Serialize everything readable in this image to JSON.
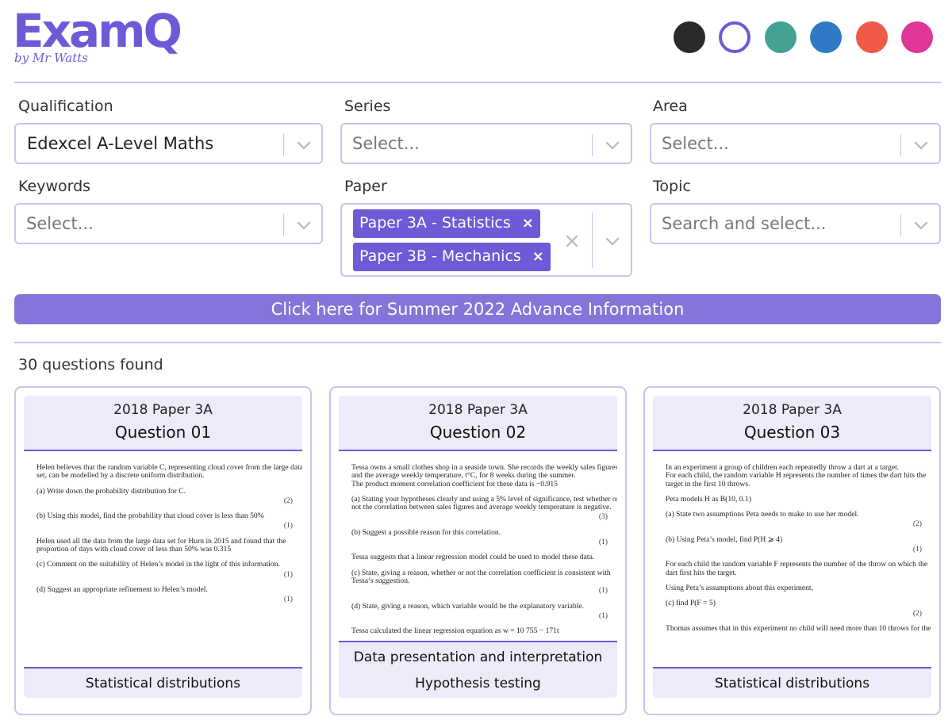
{
  "brand": {
    "name": "ExamQ",
    "tagline": "by Mr Watts",
    "accent": "#6c5ad6"
  },
  "theme_swatches": [
    {
      "name": "dark",
      "color": "#2a2a2a",
      "selected": false
    },
    {
      "name": "purple",
      "color": "#6c5ad6",
      "selected": true
    },
    {
      "name": "teal",
      "color": "#45a191",
      "selected": false
    },
    {
      "name": "blue",
      "color": "#2f79c5",
      "selected": false
    },
    {
      "name": "red",
      "color": "#ef5a48",
      "selected": false
    },
    {
      "name": "pink",
      "color": "#df3795",
      "selected": false
    }
  ],
  "filters": {
    "qualification": {
      "label": "Qualification",
      "value": "Edexcel A-Level Maths"
    },
    "series": {
      "label": "Series",
      "placeholder": "Select..."
    },
    "area": {
      "label": "Area",
      "placeholder": "Select..."
    },
    "keywords": {
      "label": "Keywords",
      "placeholder": "Select..."
    },
    "paper": {
      "label": "Paper",
      "tags": [
        "Paper 3A - Statistics",
        "Paper 3B - Mechanics"
      ],
      "tag_remove": "×"
    },
    "topic": {
      "label": "Topic",
      "placeholder": "Search and select..."
    }
  },
  "banner": {
    "text": "Click here for Summer 2022 Advance Information"
  },
  "results": {
    "count_text": "30 questions found"
  },
  "cards": [
    {
      "year": "2018 Paper 3A",
      "question": "Question 01",
      "topics": [
        "Statistical distributions"
      ],
      "content": [
        {
          "t": "Helen believes that the random variable C, representing cloud cover from the large data"
        },
        {
          "t": "set, can be modelled by a discrete uniform distribution."
        },
        {
          "t": "(a)  Write down the probability distribution for C."
        },
        {
          "m": "(2)"
        },
        {
          "t": "(b)  Using this model, find the probability that cloud cover is less than 50%"
        },
        {
          "m": "(1)"
        },
        {
          "t": "Helen used all the data from the large data set for Hurn in 2015 and found that the"
        },
        {
          "t": "proportion of days with cloud cover of less than 50% was 0.315"
        },
        {
          "t": "(c)  Comment on the suitability of Helen’s model in the light of this information."
        },
        {
          "m": "(1)"
        },
        {
          "t": "(d)  Suggest an appropriate refinement to Helen’s model."
        },
        {
          "m": "(1)"
        }
      ]
    },
    {
      "year": "2018 Paper 3A",
      "question": "Question 02",
      "topics": [
        "Data presentation and interpretation",
        "Hypothesis testing"
      ],
      "content": [
        {
          "t": "Tessa owns a small clothes shop in a seaside town.  She records the weekly sales figures, £w,"
        },
        {
          "t": "and the average weekly temperature, t°C, for 8 weeks during the summer."
        },
        {
          "t": "The product moment correlation coefficient for these data is −0.915"
        },
        {
          "t": "(a)  Stating your hypotheses clearly and using a 5% level of significance, test whether or"
        },
        {
          "t": "       not the correlation between sales figures and average weekly temperature is negative."
        },
        {
          "m": "(3)"
        },
        {
          "t": "(b)  Suggest a possible reason for this correlation."
        },
        {
          "m": "(1)"
        },
        {
          "t": "Tessa suggests that a linear regression model could be used to model these data."
        },
        {
          "t": "(c)  State, giving a reason, whether or not the correlation coefficient is consistent with"
        },
        {
          "t": "       Tessa’s suggestion."
        },
        {
          "m": "(1)"
        },
        {
          "t": "(d)  State, giving a reason, which variable would be the explanatory variable."
        },
        {
          "m": "(1)"
        },
        {
          "t": "Tessa calculated the linear regression equation as w = 10 755 − 171t"
        }
      ]
    },
    {
      "year": "2018 Paper 3A",
      "question": "Question 03",
      "topics": [
        "Statistical distributions"
      ],
      "content": [
        {
          "t": "In an experiment a group of children each repeatedly throw a dart at a target."
        },
        {
          "t": "For each child, the random variable H represents the number of times the dart hits the"
        },
        {
          "t": "target in the first 10 throws."
        },
        {
          "t": "Peta models H as B(10, 0.1)"
        },
        {
          "t": "(a)  State two assumptions Peta needs to make to use her model."
        },
        {
          "m": "(2)"
        },
        {
          "t": "(b)  Using Peta’s model, find P(H ⩾ 4)"
        },
        {
          "m": "(1)"
        },
        {
          "t": "For each child the random variable F represents the number of the throw on which the"
        },
        {
          "t": "dart first hits the target."
        },
        {
          "t": "Using Peta’s assumptions about this experiment,"
        },
        {
          "t": "(c)  find P(F = 5)"
        },
        {
          "m": "(2)"
        },
        {
          "t": "Thomas assumes that in this experiment no child will need more than 10 throws for the"
        }
      ]
    }
  ]
}
